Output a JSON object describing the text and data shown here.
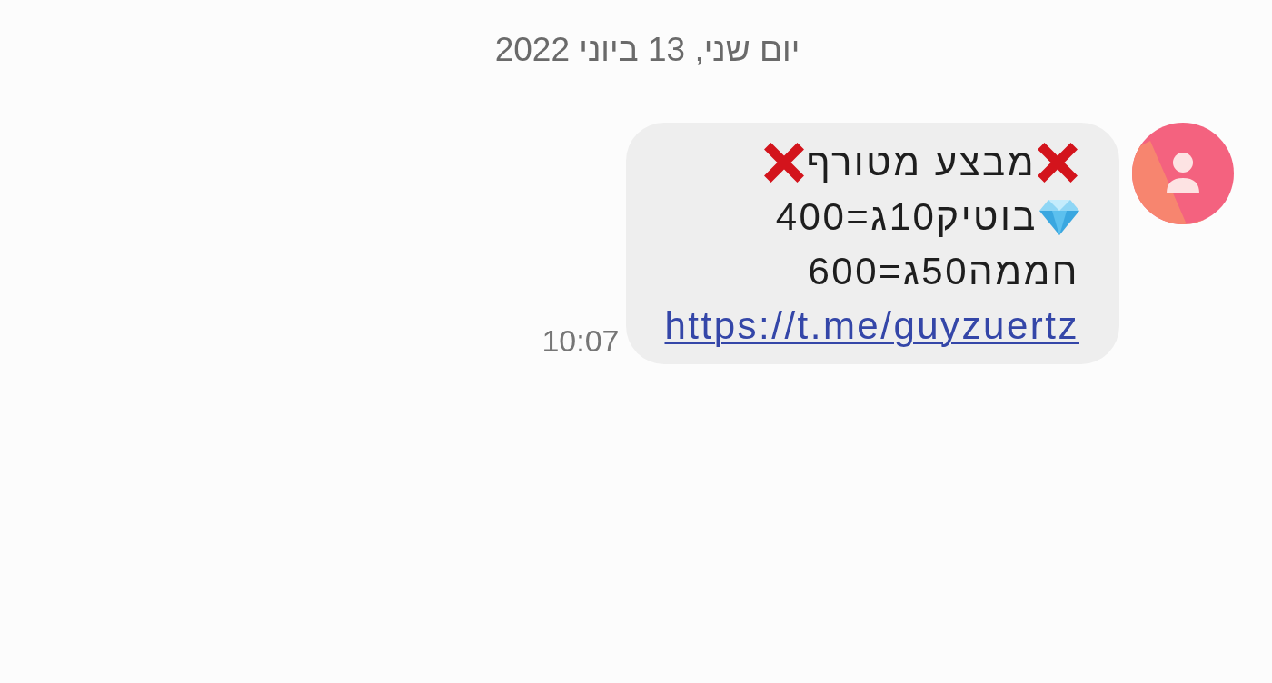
{
  "date_divider": "יום שני, 13 ביוני 2022",
  "message": {
    "time": "10:07",
    "lines": [
      {
        "kind": "crossed",
        "text": "מבצע מטורף"
      },
      {
        "kind": "gem",
        "text": "בוטיק10ג=400"
      },
      {
        "kind": "plain",
        "text": "חממה50ג=600"
      },
      {
        "kind": "link",
        "text": "https://t.me/guyzuertz"
      }
    ]
  }
}
